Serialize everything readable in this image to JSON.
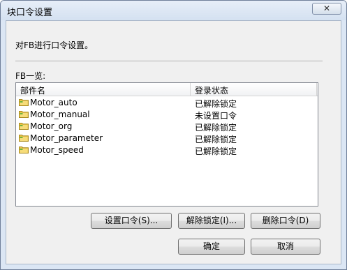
{
  "window": {
    "title": "块口令设置",
    "close_symbol": "✕"
  },
  "description": "对FB进行口令设置。",
  "fb_list_label": "FB一览:",
  "list": {
    "columns": [
      "部件名",
      "登录状态"
    ],
    "rows": [
      {
        "name": "Motor_auto",
        "status": "已解除锁定"
      },
      {
        "name": "Motor_manual",
        "status": "未设置口令"
      },
      {
        "name": "Motor_org",
        "status": "已解除锁定"
      },
      {
        "name": "Motor_parameter",
        "status": "已解除锁定"
      },
      {
        "name": "Motor_speed",
        "status": "已解除锁定"
      }
    ],
    "row_icon": "folder-icon",
    "folder_color": "#e8c44a",
    "folder_accent": "#6fb33c"
  },
  "buttons": {
    "set_password": "设置口令(S)...",
    "unlock": "解除锁定(I)...",
    "delete_password": "删除口令(D)",
    "ok": "确定",
    "cancel": "取消"
  }
}
